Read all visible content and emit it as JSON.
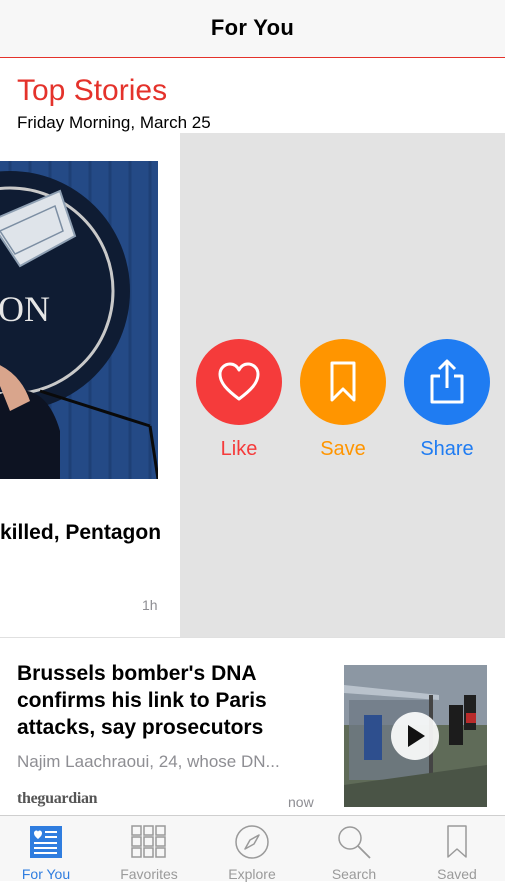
{
  "nav": {
    "title": "For You"
  },
  "section": {
    "title": "Top Stories",
    "date": "Friday Morning, March 25"
  },
  "card": {
    "headline": "killed, Pentagon",
    "time": "1h",
    "photo_text": "ON",
    "actions": [
      {
        "label": "Like",
        "icon": "heart-icon",
        "color": "#f53b3b"
      },
      {
        "label": "Save",
        "icon": "bookmark-icon",
        "color": "#ff9500"
      },
      {
        "label": "Share",
        "icon": "share-icon",
        "color": "#1f7cf2"
      }
    ]
  },
  "story2": {
    "headline": "Brussels bomber's DNA confirms his link to Paris attacks, say prosecutors",
    "snippet": "Najim Laachraoui, 24, whose DN...",
    "source": "theguardian",
    "time": "now"
  },
  "tabs": [
    {
      "label": "For You",
      "icon": "for-you-icon",
      "active": true
    },
    {
      "label": "Favorites",
      "icon": "favorites-grid-icon",
      "active": false
    },
    {
      "label": "Explore",
      "icon": "compass-icon",
      "active": false
    },
    {
      "label": "Search",
      "icon": "search-icon",
      "active": false
    },
    {
      "label": "Saved",
      "icon": "bookmark-icon",
      "active": false
    }
  ],
  "colors": {
    "accent": "#e4322b",
    "tab_active": "#2f7ddf",
    "tab_inactive": "#9a9a9a"
  }
}
